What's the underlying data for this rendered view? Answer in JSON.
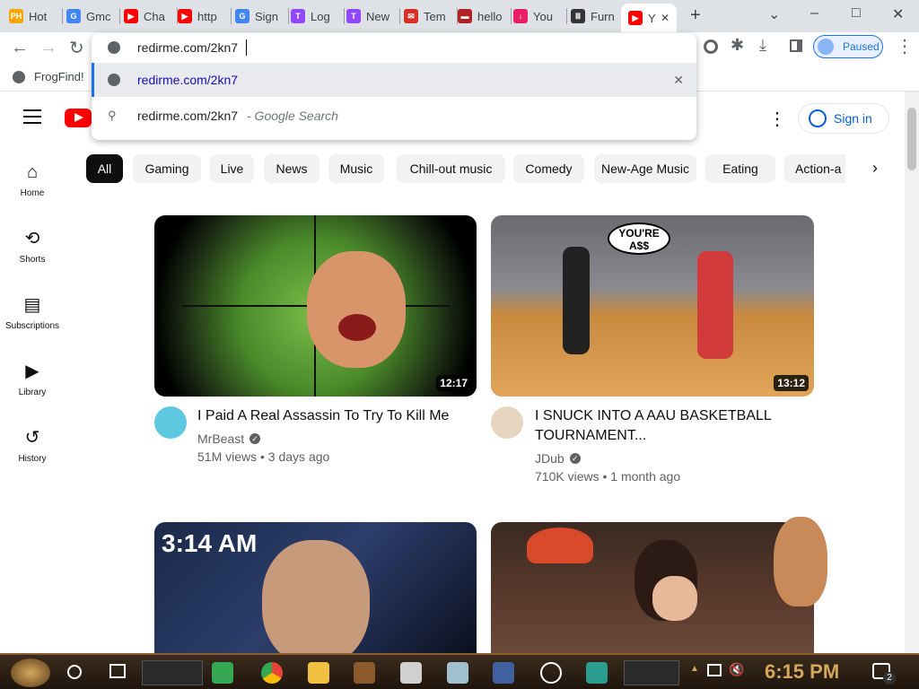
{
  "tabs": [
    {
      "label": "Hot",
      "fav": "PH",
      "color": "#f7a600"
    },
    {
      "label": "Gmc",
      "fav": "G",
      "color": "#4285f4"
    },
    {
      "label": "Cha",
      "fav": "▶",
      "color": "#ff0000"
    },
    {
      "label": "http",
      "fav": "▶",
      "color": "#ff0000"
    },
    {
      "label": "Sign",
      "fav": "G",
      "color": "#4285f4"
    },
    {
      "label": "Log",
      "fav": "T",
      "color": "#9146ff"
    },
    {
      "label": "New",
      "fav": "T",
      "color": "#9146ff"
    },
    {
      "label": "Tem",
      "fav": "✉",
      "color": "#d93025"
    },
    {
      "label": "hello",
      "fav": "▬",
      "color": "#b22222"
    },
    {
      "label": "You",
      "fav": "↓",
      "color": "#e91e63"
    },
    {
      "label": "Furn",
      "fav": "Ⅲ",
      "color": "#333333"
    },
    {
      "label": "Y",
      "fav": "▶",
      "color": "#ff0000"
    }
  ],
  "new_tab": "+",
  "window_controls": {
    "chevron": "⌄",
    "minimize": "–",
    "maximize": "□",
    "close": "✕"
  },
  "profile": {
    "label": "Paused"
  },
  "bookmark": {
    "label": "FrogFind!"
  },
  "omnibox": {
    "input": "redirme.com/2kn7",
    "suggestions": [
      {
        "text": "redirme.com/2kn7",
        "type": "url"
      },
      {
        "text": "redirme.com/2kn7",
        "suffix": " - Google Search",
        "type": "search"
      }
    ]
  },
  "header": {
    "sign_in": "Sign in"
  },
  "chips": [
    "All",
    "Gaming",
    "Live",
    "News",
    "Music",
    "Chill-out music",
    "Comedy",
    "New-Age Music",
    "Eating",
    "Action-a"
  ],
  "sidebar": [
    {
      "label": "Home",
      "icon": "home-icon"
    },
    {
      "label": "Shorts",
      "icon": "shorts-icon"
    },
    {
      "label": "Subscriptions",
      "icon": "subscriptions-icon"
    },
    {
      "label": "Library",
      "icon": "library-icon"
    },
    {
      "label": "History",
      "icon": "history-icon"
    }
  ],
  "videos": [
    {
      "title": "I Paid A Real Assassin To Try To Kill Me",
      "channel": "MrBeast",
      "meta": "51M views • 3 days ago",
      "duration": "12:17"
    },
    {
      "title": "I SNUCK INTO A AAU BASKETBALL TOURNAMENT...",
      "channel": "JDub",
      "meta": "710K views • 1 month ago",
      "duration": "13:12",
      "overlay": "YOU'RE A$$"
    },
    {
      "title": "",
      "overlay": "3:14 AM"
    },
    {
      "title": ""
    }
  ],
  "taskbar": {
    "clock": "6:15 PM",
    "notif_count": "2"
  }
}
